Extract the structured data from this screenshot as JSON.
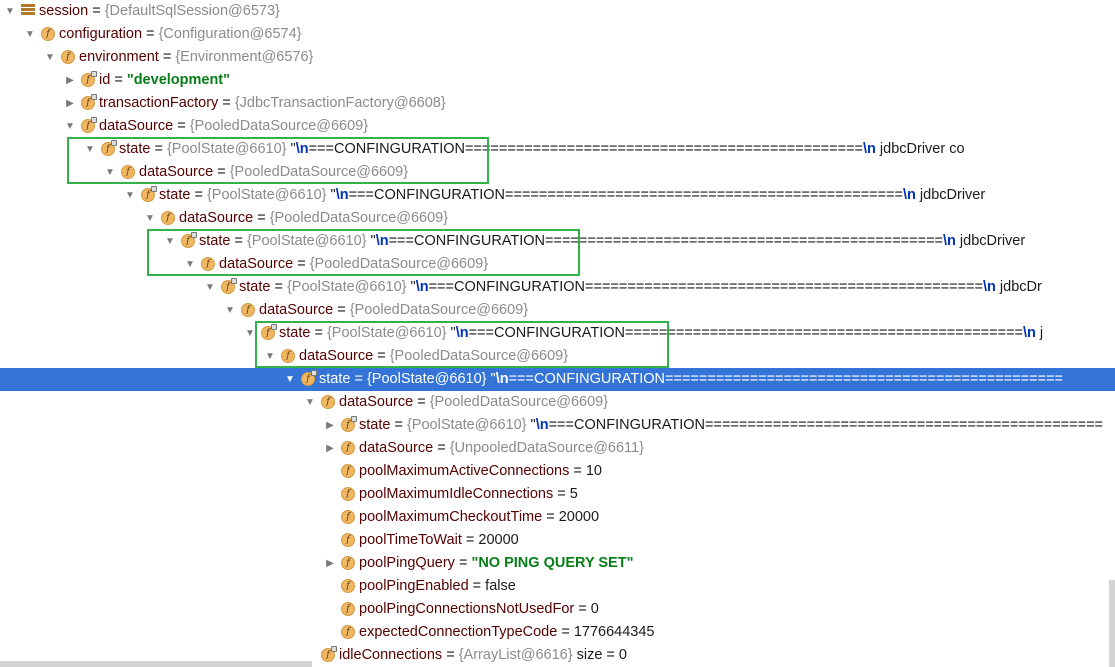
{
  "tree": {
    "rows": [
      {
        "indent": 0,
        "arrow": "▼",
        "icon": "struct",
        "name": "session",
        "value": "{DefaultSqlSession@6573}"
      },
      {
        "indent": 1,
        "arrow": "▼",
        "icon": "field",
        "name": "configuration",
        "value": "{Configuration@6574}"
      },
      {
        "indent": 2,
        "arrow": "▼",
        "icon": "field",
        "name": "environment",
        "value": "{Environment@6576}"
      },
      {
        "indent": 3,
        "arrow": "▶",
        "icon": "field-final",
        "name": "id",
        "strval": "\"development\""
      },
      {
        "indent": 3,
        "arrow": "▶",
        "icon": "field-final",
        "name": "transactionFactory",
        "value": "{JdbcTransactionFactory@6608}"
      },
      {
        "indent": 3,
        "arrow": "▼",
        "icon": "field-final",
        "name": "dataSource",
        "value": "{PooledDataSource@6609}"
      },
      {
        "indent": 4,
        "arrow": "▼",
        "icon": "field-final",
        "name": "state",
        "value": "{PoolState@6610}",
        "prefix": " \"",
        "esc": "\\n",
        "tail": "===CONFINGURATION===============================================",
        "esc2": "\\n",
        "tail2": " jdbcDriver                   co"
      },
      {
        "indent": 5,
        "arrow": "▼",
        "icon": "field",
        "name": "dataSource",
        "value": "{PooledDataSource@6609}"
      },
      {
        "indent": 6,
        "arrow": "▼",
        "icon": "field-final",
        "name": "state",
        "value": "{PoolState@6610}",
        "prefix": " \"",
        "esc": "\\n",
        "tail": "===CONFINGURATION===============================================",
        "esc2": "\\n",
        "tail2": " jdbcDriver"
      },
      {
        "indent": 7,
        "arrow": "▼",
        "icon": "field",
        "name": "dataSource",
        "value": "{PooledDataSource@6609}"
      },
      {
        "indent": 8,
        "arrow": "▼",
        "icon": "field-final",
        "name": "state",
        "value": "{PoolState@6610}",
        "prefix": " \"",
        "esc": "\\n",
        "tail": "===CONFINGURATION===============================================",
        "esc2": "\\n",
        "tail2": " jdbcDriver"
      },
      {
        "indent": 9,
        "arrow": "▼",
        "icon": "field",
        "name": "dataSource",
        "value": "{PooledDataSource@6609}"
      },
      {
        "indent": 10,
        "arrow": "▼",
        "icon": "field-final",
        "name": "state",
        "value": "{PoolState@6610}",
        "prefix": " \"",
        "esc": "\\n",
        "tail": "===CONFINGURATION===============================================",
        "esc2": "\\n",
        "tail2": " jdbcDr"
      },
      {
        "indent": 11,
        "arrow": "▼",
        "icon": "field",
        "name": "dataSource",
        "value": "{PooledDataSource@6609}"
      },
      {
        "indent": 12,
        "arrow": "▼",
        "icon": "field-final",
        "name": "state",
        "value": "{PoolState@6610}",
        "prefix": " \"",
        "esc": "\\n",
        "tail": "===CONFINGURATION===============================================",
        "esc2": "\\n",
        "tail2": " j"
      },
      {
        "indent": 13,
        "arrow": "▼",
        "icon": "field",
        "name": "dataSource",
        "value": "{PooledDataSource@6609}"
      },
      {
        "indent": 14,
        "arrow": "▼",
        "icon": "field-final",
        "name": "state",
        "value": "{PoolState@6610}",
        "prefix": " \"",
        "esc": "\\n",
        "tail": "===CONFINGURATION===============================================",
        "selected": true
      },
      {
        "indent": 15,
        "arrow": "▼",
        "icon": "field",
        "name": "dataSource",
        "value": "{PooledDataSource@6609}"
      },
      {
        "indent": 16,
        "arrow": "▶",
        "icon": "field-final",
        "name": "state",
        "value": "{PoolState@6610}",
        "prefix": " \"",
        "esc": "\\n",
        "tail": "===CONFINGURATION==============================================="
      },
      {
        "indent": 16,
        "arrow": "▶",
        "icon": "field",
        "name": "dataSource",
        "value": "{UnpooledDataSource@6611}"
      },
      {
        "indent": 16,
        "arrow": "",
        "icon": "field",
        "name": "poolMaximumActiveConnections",
        "num": " = 10"
      },
      {
        "indent": 16,
        "arrow": "",
        "icon": "field",
        "name": "poolMaximumIdleConnections",
        "num": " = 5"
      },
      {
        "indent": 16,
        "arrow": "",
        "icon": "field",
        "name": "poolMaximumCheckoutTime",
        "num": " = 20000"
      },
      {
        "indent": 16,
        "arrow": "",
        "icon": "field",
        "name": "poolTimeToWait",
        "num": " = 20000"
      },
      {
        "indent": 16,
        "arrow": "▶",
        "icon": "field",
        "name": "poolPingQuery",
        "strval": "\"NO PING QUERY SET\""
      },
      {
        "indent": 16,
        "arrow": "",
        "icon": "field",
        "name": "poolPingEnabled",
        "num": " = false"
      },
      {
        "indent": 16,
        "arrow": "",
        "icon": "field",
        "name": "poolPingConnectionsNotUsedFor",
        "num": " = 0"
      },
      {
        "indent": 16,
        "arrow": "",
        "icon": "field",
        "name": "expectedConnectionTypeCode",
        "num": " = 1776644345"
      },
      {
        "indent": 15,
        "arrow": "",
        "icon": "field-final",
        "name": "idleConnections",
        "value": "{ArrayList@6616}",
        "num": "  size = 0"
      }
    ]
  }
}
